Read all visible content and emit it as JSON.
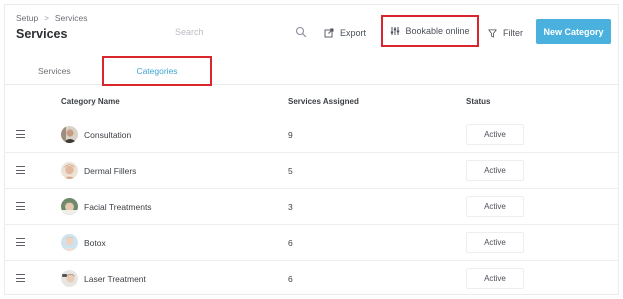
{
  "breadcrumb": {
    "root": "Setup",
    "separator": ">",
    "current": "Services"
  },
  "page_title": "Services",
  "search": {
    "placeholder": "Search",
    "icon": "search-icon"
  },
  "toolbar": {
    "export_label": "Export",
    "bookable_label": "Bookable online",
    "filter_label": "Filter",
    "new_category_label": "New Category"
  },
  "tabs": [
    {
      "label": "Services",
      "active": false
    },
    {
      "label": "Categories",
      "active": true
    }
  ],
  "table": {
    "headers": {
      "name": "Category Name",
      "count": "Services Assigned",
      "status": "Status"
    },
    "rows": [
      {
        "name": "Consultation",
        "count": "9",
        "status": "Active"
      },
      {
        "name": "Dermal Fillers",
        "count": "5",
        "status": "Active"
      },
      {
        "name": "Facial Treatments",
        "count": "3",
        "status": "Active"
      },
      {
        "name": "Botox",
        "count": "6",
        "status": "Active"
      },
      {
        "name": "Laser Treatment",
        "count": "6",
        "status": "Active"
      }
    ]
  },
  "colors": {
    "accent": "#4ab1de",
    "tab_active": "#3ea4d3",
    "highlight_box": "#d9262c"
  }
}
